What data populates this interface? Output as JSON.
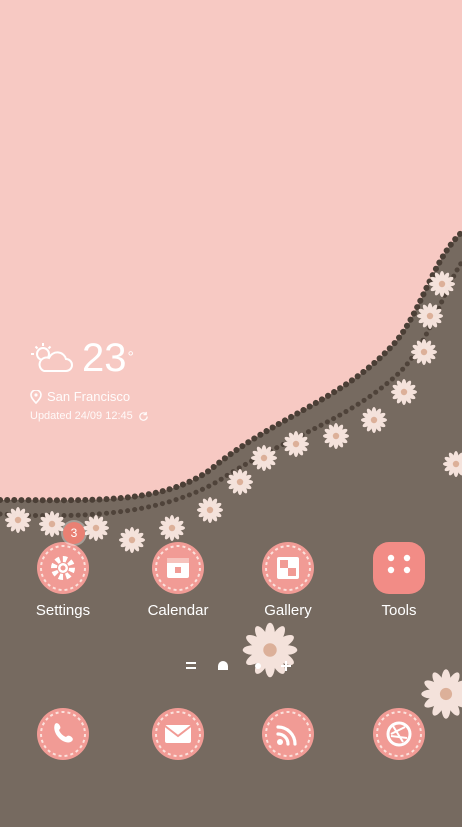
{
  "weather": {
    "temperature": "23",
    "degree_symbol": "°",
    "location": "San Francisco",
    "updated": "Updated 24/09 12:45"
  },
  "apps": [
    {
      "label": "Settings",
      "icon": "gear-icon",
      "badge": "3"
    },
    {
      "label": "Calendar",
      "icon": "calendar-icon"
    },
    {
      "label": "Gallery",
      "icon": "gallery-icon"
    },
    {
      "label": "Tools",
      "icon": "tools-folder-icon"
    }
  ],
  "dock": [
    {
      "icon": "phone-icon"
    },
    {
      "icon": "mail-icon"
    },
    {
      "icon": "rss-icon"
    },
    {
      "icon": "camera-shutter-icon"
    }
  ],
  "colors": {
    "sky": "#f7c9c3",
    "ground": "#766a60",
    "bead": "#4b3f36",
    "accent": "#f19b95",
    "badge": "#e98073"
  }
}
